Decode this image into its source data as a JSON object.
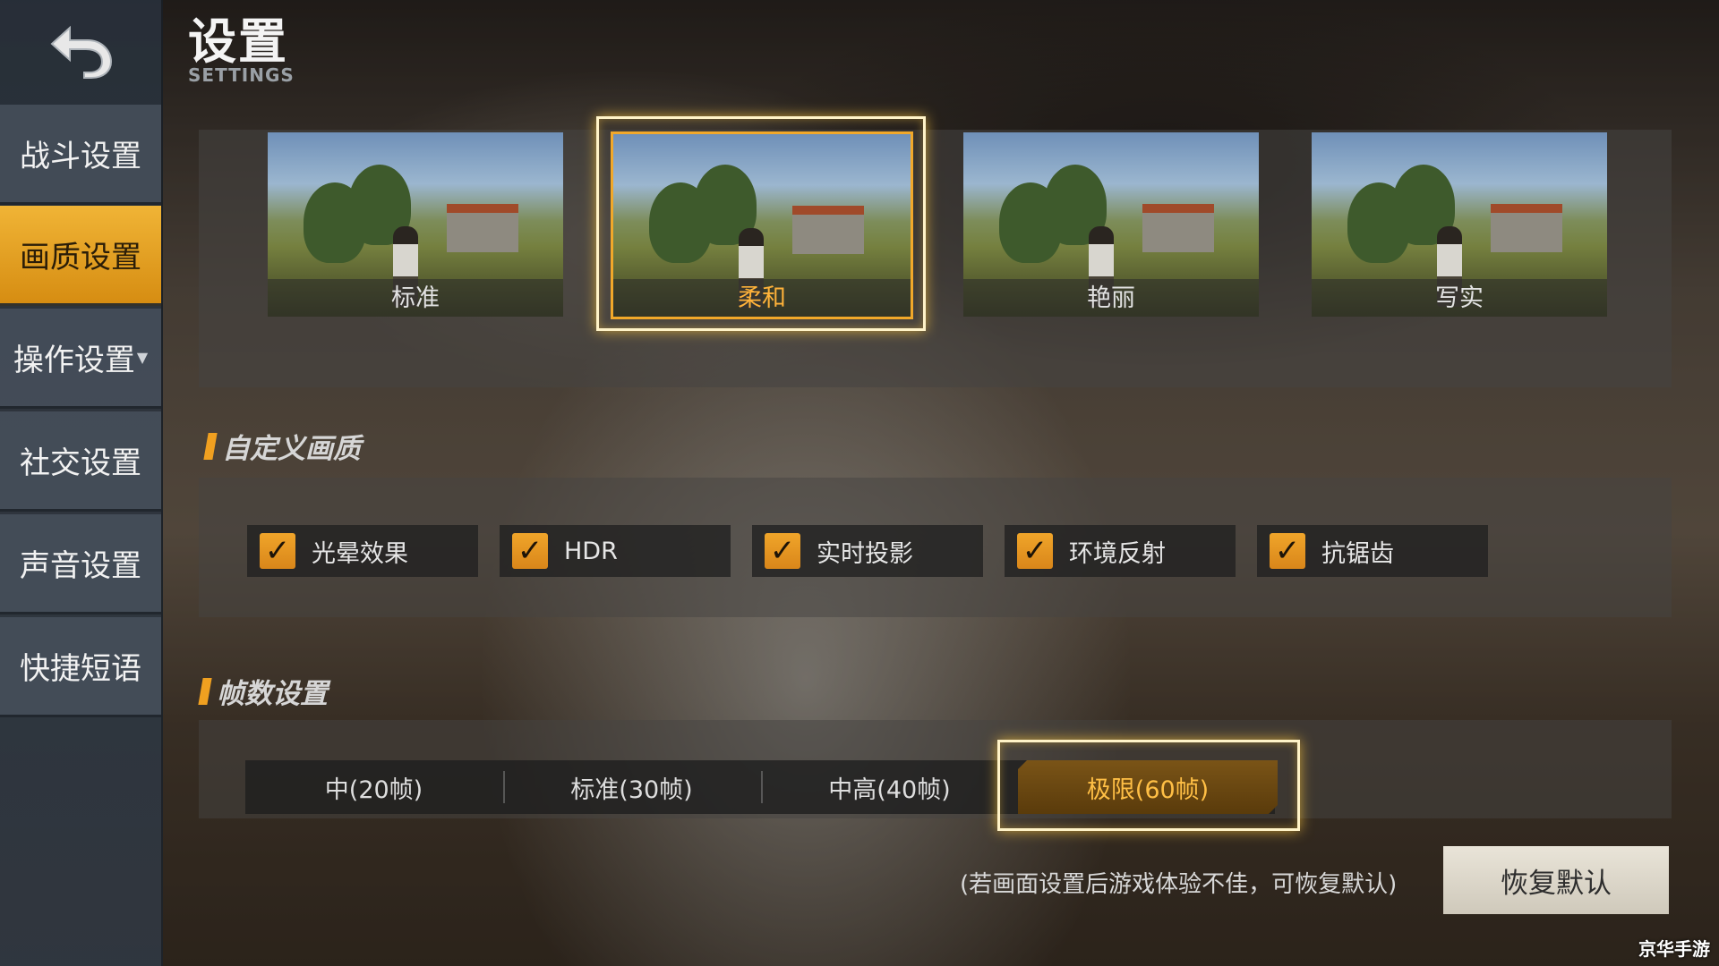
{
  "header": {
    "title": "设置",
    "subtitle": "SETTINGS"
  },
  "sidebar": {
    "items": [
      {
        "label": "战斗设置"
      },
      {
        "label": "画质设置"
      },
      {
        "label": "操作设置"
      },
      {
        "label": "社交设置"
      },
      {
        "label": "声音设置"
      },
      {
        "label": "快捷短语"
      }
    ],
    "active_index": 1
  },
  "quality_presets": {
    "options": [
      "标准",
      "柔和",
      "艳丽",
      "写实"
    ],
    "selected": "柔和"
  },
  "custom_quality": {
    "heading": "自定义画质",
    "options": [
      {
        "label": "光晕效果",
        "checked": true
      },
      {
        "label": "HDR",
        "checked": true
      },
      {
        "label": "实时投影",
        "checked": true
      },
      {
        "label": "环境反射",
        "checked": true
      },
      {
        "label": "抗锯齿",
        "checked": true
      }
    ]
  },
  "frame_rate": {
    "heading": "帧数设置",
    "options": [
      "中(20帧)",
      "标准(30帧)",
      "中高(40帧)",
      "极限(60帧)"
    ],
    "selected": "极限(60帧)"
  },
  "footer": {
    "hint": "(若画面设置后游戏体验不佳，可恢复默认)",
    "restore_label": "恢复默认"
  },
  "watermark": "京华手游",
  "colors": {
    "accent": "#f0a52a",
    "selected_text": "#ffbf45"
  },
  "icons": {
    "back": "back-arrow-icon",
    "check": "check-icon",
    "dropdown": "caret-down-icon"
  }
}
